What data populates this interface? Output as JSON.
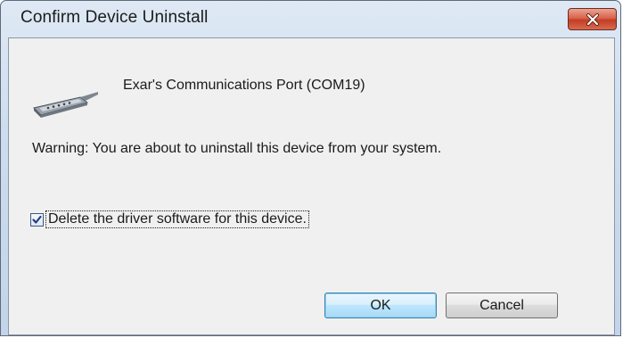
{
  "dialog": {
    "title": "Confirm Device Uninstall",
    "device_name": "Exar's Communications Port (COM19)",
    "warning_text": "Warning: You are about to uninstall this device from your system.",
    "checkbox": {
      "label": "Delete the driver software for this device.",
      "checked": true
    },
    "buttons": {
      "ok_label": "OK",
      "cancel_label": "Cancel"
    }
  },
  "icons": {
    "close": "close-icon",
    "device": "serial-port-icon",
    "check": "checkmark-icon"
  },
  "colors": {
    "close_button": "#c94a32",
    "default_button_border": "#3c7fb1",
    "client_background": "#f0f0f0"
  }
}
